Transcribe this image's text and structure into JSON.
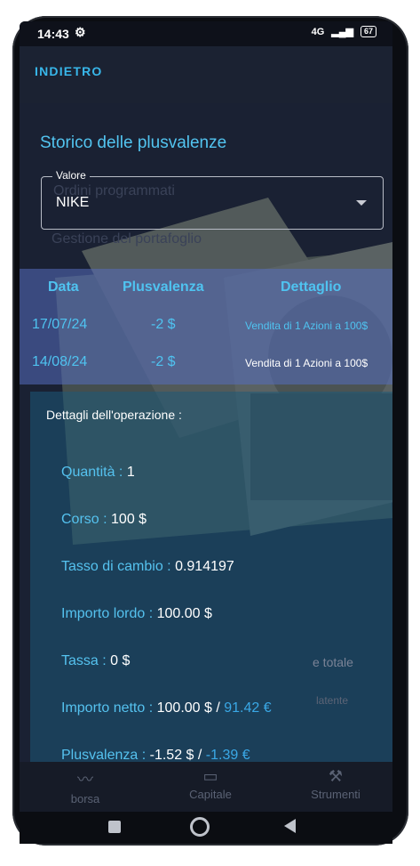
{
  "status_bar": {
    "time": "14:43",
    "network": "4G",
    "battery": "67"
  },
  "app_bar": {
    "back_label": "INDIETRO"
  },
  "page": {
    "title": "Storico delle plusvalenze"
  },
  "background_hints": {
    "line1": "Ordini programmati",
    "line2": "Gestione del portafoglio",
    "sort_label": "e totale",
    "latent_label": "latente"
  },
  "select": {
    "label": "Valore",
    "value": "NIKE"
  },
  "table": {
    "headers": [
      "Data",
      "Plusvalenza",
      "Dettaglio"
    ],
    "rows": [
      {
        "date": "17/07/24",
        "gain": "-2 $",
        "detail": "Vendita di 1 Azioni a 100$"
      },
      {
        "date": "14/08/24",
        "gain": "-2 $",
        "detail": "Vendita di 1 Azioni a 100$"
      }
    ]
  },
  "details": {
    "heading": "Dettagli dell'operazione :",
    "quantity_label": "Quantità :",
    "quantity_value": "1",
    "price_label": "Corso :",
    "price_value": "100 $",
    "fx_label": "Tasso di cambio :",
    "fx_value": "0.914197",
    "gross_label": "Importo lordo :",
    "gross_value": "100.00 $",
    "tax_label": "Tassa :",
    "tax_value": "0 $",
    "net_label": "Importo netto :",
    "net_value": "100.00 $ /",
    "net_eur": "91.42 €",
    "gain_label": "Plusvalenza :",
    "gain_value": "-1.52 $ /",
    "gain_eur": "-1.39 €"
  },
  "bottom_tabs": [
    "borsa",
    "Capitale",
    "Strumenti"
  ],
  "colors": {
    "accent": "#4fc3f0",
    "background": "#1a2133",
    "table_band": "#566ebe"
  },
  "icons": [
    "gear-icon",
    "chart-icon",
    "money-icon",
    "hammer-icon"
  ]
}
